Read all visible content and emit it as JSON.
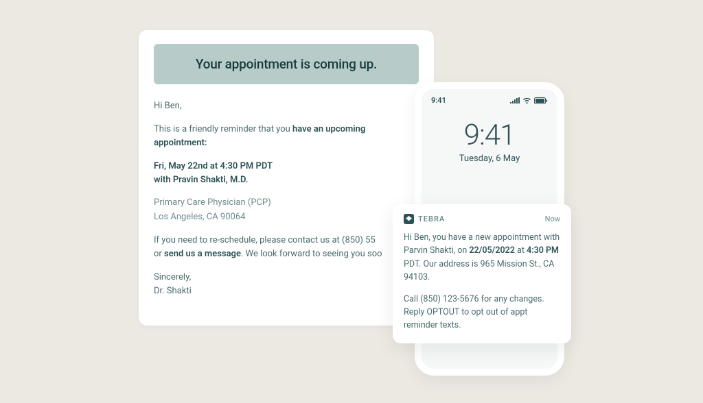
{
  "email": {
    "banner": "Your appointment is coming up.",
    "greeting": "Hi Ben,",
    "intro_pre": "This is a friendly reminder that you ",
    "intro_strong": "have an upcoming appointment:",
    "appt_line1": "Fri, May 22nd at 4:30 PM PDT",
    "appt_line2": "with Pravin Shakti, M.D.",
    "meta_line1": "Primary Care Physician (PCP)",
    "meta_line2": "Los Angeles, CA 90064",
    "resched_pre": "If you need to re-schedule, please contact us at (850)  55",
    "resched_or": "or ",
    "resched_link": "send us a message",
    "resched_post": ". We look forward to seeing you soo",
    "signoff1": "Sincerely,",
    "signoff2": "Dr. Shakti"
  },
  "phone": {
    "status_time": "9:41",
    "lock_time": "9:41",
    "lock_date": "Tuesday, 6 May"
  },
  "notif": {
    "app": "TEBRA",
    "when": "Now",
    "line1_pre": "Hi Ben, you have a new appointment with Parvin Shakti, on ",
    "line1_date": "22/05/2022",
    "line1_mid": " at ",
    "line1_time": "4:30 PM",
    "line1_post": " PDT. Our address is 965 Mission St., CA 94103.",
    "line2": "Call (850) 123-5676 for any changes. Reply OPTOUT to opt out of appt reminder texts."
  }
}
